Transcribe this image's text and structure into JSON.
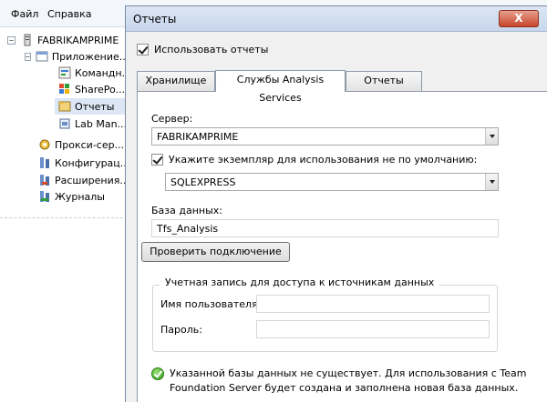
{
  "menubar": {
    "items": [
      "Файл",
      "Справка"
    ]
  },
  "tree": {
    "items": [
      {
        "label": "FABRIKAMPRIME",
        "expander": "−",
        "icon": "server-icon"
      },
      {
        "label": "Приложение...",
        "expander": "−",
        "icon": "application-icon"
      },
      {
        "label": "Командн...",
        "expander": "",
        "icon": "team-icon"
      },
      {
        "label": "SharePo...",
        "expander": "",
        "icon": "sharepoint-icon"
      },
      {
        "label": "Отчеты",
        "expander": "",
        "icon": "reports-icon",
        "selected": true
      },
      {
        "label": "Lab Man...",
        "expander": "",
        "icon": "lab-icon"
      },
      {
        "label": "Прокси-сер...",
        "expander": "",
        "icon": "proxy-icon"
      },
      {
        "label": "Конфигурац...",
        "expander": "",
        "icon": "config-icon"
      },
      {
        "label": "Расширения...",
        "expander": "",
        "icon": "extensions-icon"
      },
      {
        "label": "Журналы",
        "expander": "",
        "icon": "logs-icon"
      }
    ]
  },
  "dialog": {
    "title": "Отчеты",
    "close_label": "X",
    "use_reports_label": "Использовать отчеты",
    "tabs": [
      {
        "label": "Хранилище",
        "active": false
      },
      {
        "label": "Службы Analysis Services",
        "active": true
      },
      {
        "label": "Отчеты",
        "active": false
      }
    ],
    "server_label": "Сервер:",
    "server_value": "FABRIKAMPRIME",
    "instance_check_label": "Укажите экземпляр для использования не по умолчанию:",
    "instance_value": "SQLEXPRESS",
    "database_label": "База данных:",
    "database_value": "Tfs_Analysis",
    "test_button_label": "Проверить подключение",
    "account_group_title": "Учетная запись для доступа к источникам данных",
    "username_label": "Имя пользователя:",
    "username_value": "",
    "password_label": "Пароль:",
    "password_value": "",
    "status_line1": "Указанной базы данных не существует. Для использования с Team",
    "status_line2": "Foundation Server будет создана и заполнена новая база данных."
  },
  "colors": {
    "accent_close": "#c6452b",
    "selection": "#dde6f4",
    "ok_green": "#2f9a17"
  }
}
